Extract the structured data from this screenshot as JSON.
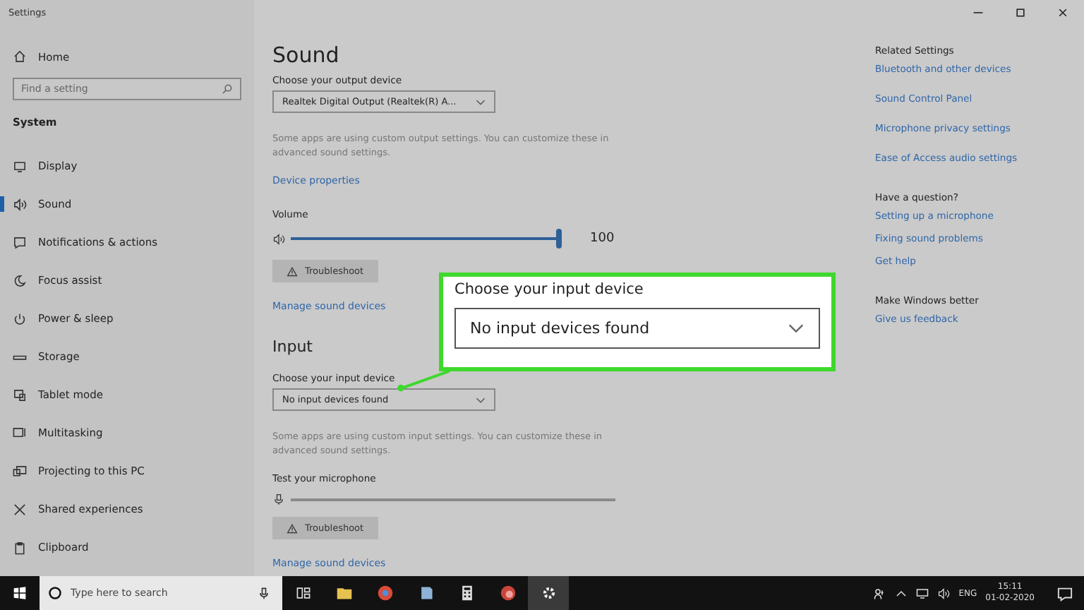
{
  "window": {
    "title": "Settings"
  },
  "sidebar": {
    "home": "Home",
    "search": {
      "placeholder": "Find a setting"
    },
    "section": "System",
    "items": [
      {
        "label": "Display",
        "selected": false
      },
      {
        "label": "Sound",
        "selected": true
      },
      {
        "label": "Notifications & actions",
        "selected": false
      },
      {
        "label": "Focus assist",
        "selected": false
      },
      {
        "label": "Power & sleep",
        "selected": false
      },
      {
        "label": "Storage",
        "selected": false
      },
      {
        "label": "Tablet mode",
        "selected": false
      },
      {
        "label": "Multitasking",
        "selected": false
      },
      {
        "label": "Projecting to this PC",
        "selected": false
      },
      {
        "label": "Shared experiences",
        "selected": false
      },
      {
        "label": "Clipboard",
        "selected": false
      }
    ]
  },
  "main": {
    "title": "Sound",
    "output": {
      "label": "Choose your output device",
      "device": "Realtek Digital Output (Realtek(R) A...",
      "note": "Some apps are using custom output settings. You can customize these in advanced sound settings.",
      "properties_link": "Device properties",
      "volume_label": "Volume",
      "volume": {
        "level": 1.0,
        "reading": "100"
      },
      "troubleshoot": "Troubleshoot",
      "manage_link": "Manage sound devices"
    },
    "input": {
      "heading": "Input",
      "label": "Choose your input device",
      "device": "No input devices found",
      "note": "Some apps are using custom input settings. You can customize these in advanced sound settings.",
      "test_label": "Test your microphone",
      "mic": {
        "level": 0
      },
      "troubleshoot": "Troubleshoot",
      "manage_link": "Manage sound devices"
    }
  },
  "related": [
    {
      "heading": "Related Settings",
      "links": [
        "Bluetooth and other devices",
        "Sound Control Panel",
        "Microphone privacy settings",
        "Ease of Access audio settings"
      ]
    },
    {
      "heading": "Have a question?",
      "links": [
        "Setting up a microphone",
        "Fixing sound problems",
        "Get help"
      ]
    },
    {
      "heading": "Make Windows better",
      "links": [
        "Give us feedback"
      ]
    }
  ],
  "callout": {
    "label": "Choose your input device",
    "device": "No input devices found"
  },
  "taskbar": {
    "search": {
      "placeholder": "Type here to search"
    },
    "apps": [
      {
        "selected": false
      },
      {
        "selected": false
      },
      {
        "selected": false
      },
      {
        "selected": false
      },
      {
        "selected": false
      },
      {
        "selected": false
      },
      {
        "selected": true
      }
    ],
    "language": "ENG",
    "time": "15:11",
    "date": "01-02-2020"
  }
}
